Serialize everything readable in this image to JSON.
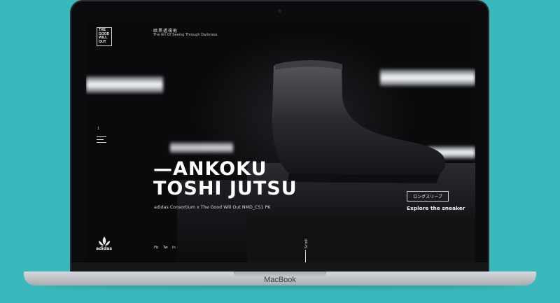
{
  "laptop": {
    "brand": "MacBook"
  },
  "site": {
    "logo_lines": [
      "THE",
      "GOOD",
      "WILL",
      "OUT"
    ],
    "tagline_jp": "暗黒透視術",
    "tagline_en": "The Art Of Seeing Through Darkness",
    "slide_number": "1",
    "headline_line1": "—ANKOKU",
    "headline_line2": "TOSHI JUTSU",
    "subline": "adidas Consortium x The Good Will Out NMD_CS1 PK",
    "cta_jp": "ロングスリーブ",
    "cta_explore": "Explore the sneaker",
    "adidas_text": "adidas",
    "social": {
      "fb": "Fb",
      "tw": "Tw",
      "in": "In"
    },
    "scroll": "Scroll"
  },
  "colors": {
    "background": "#3bb8bb",
    "screen": "#0a0a0c",
    "text": "#ffffff"
  }
}
